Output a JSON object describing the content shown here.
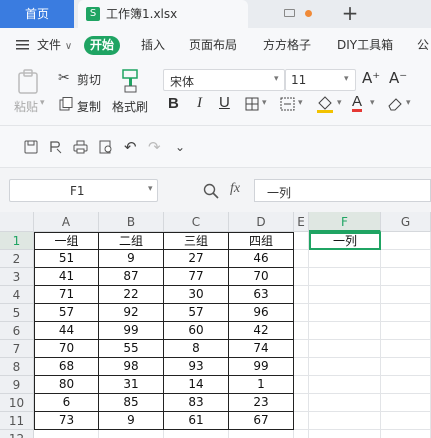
{
  "tabs": {
    "home": "首页",
    "file_icon": "S",
    "file_name": "工作簿1.xlsx",
    "new_tab": "+"
  },
  "menu": {
    "file": "文件",
    "start": "开始",
    "insert": "插入",
    "page_layout": "页面布局",
    "fangfang": "方方格子",
    "diy": "DIY工具箱",
    "more": "公"
  },
  "ribbon": {
    "paste": "粘贴",
    "cut": "剪切",
    "copy": "复制",
    "format_painter": "格式刷",
    "font_name": "宋体",
    "font_size": "11",
    "bold": "B",
    "italic": "I",
    "underline": "U",
    "font_color_letter": "A",
    "grow_font": "A⁺",
    "shrink_font": "A⁻"
  },
  "formula": {
    "cell_ref": "F1",
    "fx": "fx",
    "content": "一列"
  },
  "grid": {
    "columns": [
      "A",
      "B",
      "C",
      "D",
      "E",
      "F",
      "G"
    ],
    "rows": [
      "1",
      "2",
      "3",
      "4",
      "5",
      "6",
      "7",
      "8",
      "9",
      "10",
      "11",
      "12"
    ],
    "header_row": [
      "一组",
      "二组",
      "三组",
      "四组"
    ],
    "data": [
      [
        "51",
        "9",
        "27",
        "46"
      ],
      [
        "41",
        "87",
        "77",
        "70"
      ],
      [
        "71",
        "22",
        "30",
        "63"
      ],
      [
        "57",
        "92",
        "57",
        "96"
      ],
      [
        "44",
        "99",
        "60",
        "42"
      ],
      [
        "70",
        "55",
        "8",
        "74"
      ],
      [
        "68",
        "98",
        "93",
        "99"
      ],
      [
        "80",
        "31",
        "14",
        "1"
      ],
      [
        "6",
        "85",
        "83",
        "23"
      ],
      [
        "73",
        "9",
        "61",
        "67"
      ]
    ],
    "f1": "一列",
    "active_column": "F",
    "active_row": "1"
  },
  "colors": {
    "accent": "#3a7ce0",
    "start_tab": "#1fa463",
    "selection": "#1fa463"
  }
}
